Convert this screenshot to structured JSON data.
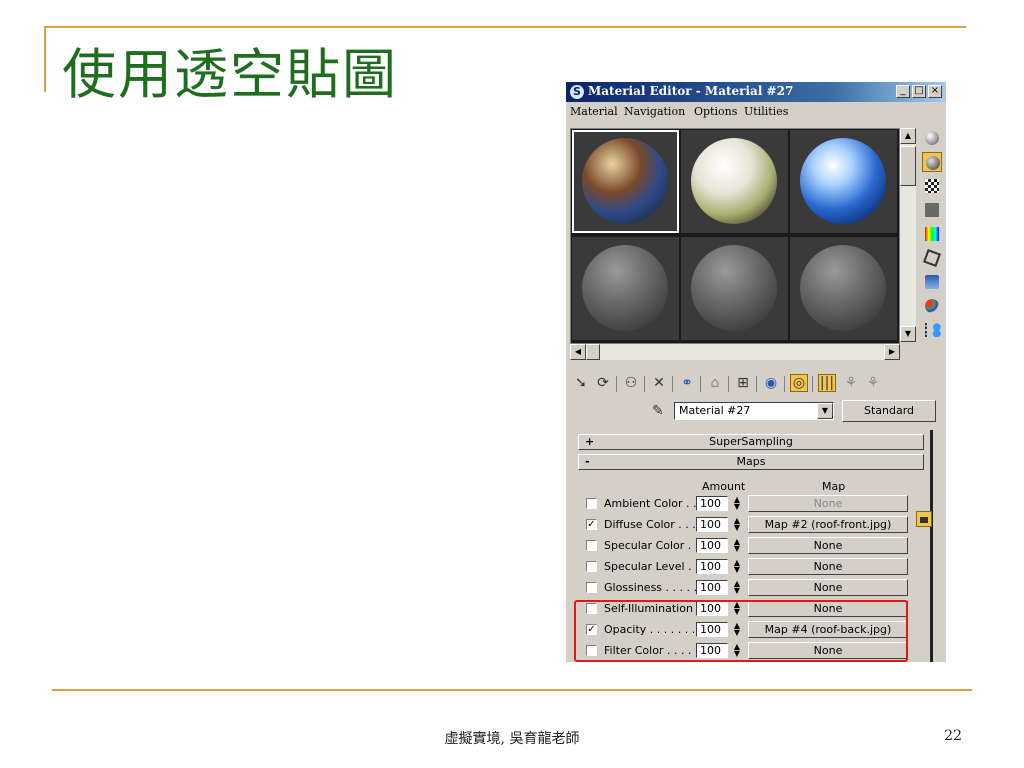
{
  "slide": {
    "title": "使用透空貼圖",
    "footer": "虛擬實境, 吳育龍老師",
    "page_number": "22",
    "accent_color": "#d9a24a",
    "title_color": "#1f6e1f"
  },
  "window": {
    "title": "Material Editor - Material #27",
    "controls": {
      "minimize": "_",
      "maximize": "□",
      "close": "×"
    },
    "menu": [
      "Material",
      "Navigation",
      "Options",
      "Utilities"
    ]
  },
  "sample_slots": [
    {
      "kind": "textured-sphere",
      "active": true
    },
    {
      "kind": "textured-sphere",
      "active": false
    },
    {
      "kind": "sky-sphere",
      "active": false
    },
    {
      "kind": "default-sphere",
      "active": false
    },
    {
      "kind": "default-sphere",
      "active": false
    },
    {
      "kind": "default-sphere",
      "active": false
    }
  ],
  "side_tools": [
    "sample-type-sphere-icon",
    "backlight-icon",
    "background-checker-icon",
    "sample-uv-tiling-icon",
    "video-color-check-icon",
    "make-preview-icon",
    "options-icon",
    "select-by-material-icon",
    "material-map-navigator-icon"
  ],
  "material": {
    "name": "Material #27",
    "type": "Standard"
  },
  "rollouts": {
    "supersampling": {
      "sign": "+",
      "label": "SuperSampling"
    },
    "maps": {
      "sign": "-",
      "label": "Maps"
    }
  },
  "maps_table": {
    "amount_header": "Amount",
    "map_header": "Map",
    "rows": [
      {
        "label": "Ambient Color . . .",
        "checked": false,
        "amount": "100",
        "map": "None",
        "disabled": true
      },
      {
        "label": "Diffuse Color . . . .",
        "checked": true,
        "amount": "100",
        "map": "Map #2 (roof-front.jpg)",
        "disabled": false
      },
      {
        "label": "Specular Color . .",
        "checked": false,
        "amount": "100",
        "map": "None",
        "disabled": false
      },
      {
        "label": "Specular Level .",
        "checked": false,
        "amount": "100",
        "map": "None",
        "disabled": false
      },
      {
        "label": "Glossiness . . . . .",
        "checked": false,
        "amount": "100",
        "map": "None",
        "disabled": false
      },
      {
        "label": "Self-Illumination .",
        "checked": false,
        "amount": "100",
        "map": "None",
        "disabled": false
      },
      {
        "label": "Opacity . . . . . . . .",
        "checked": true,
        "amount": "100",
        "map": "Map #4 (roof-back.jpg)",
        "disabled": false
      },
      {
        "label": "Filter Color . . . . . .",
        "checked": false,
        "amount": "100",
        "map": "None",
        "disabled": false
      }
    ]
  },
  "highlight_color": "#e01818"
}
